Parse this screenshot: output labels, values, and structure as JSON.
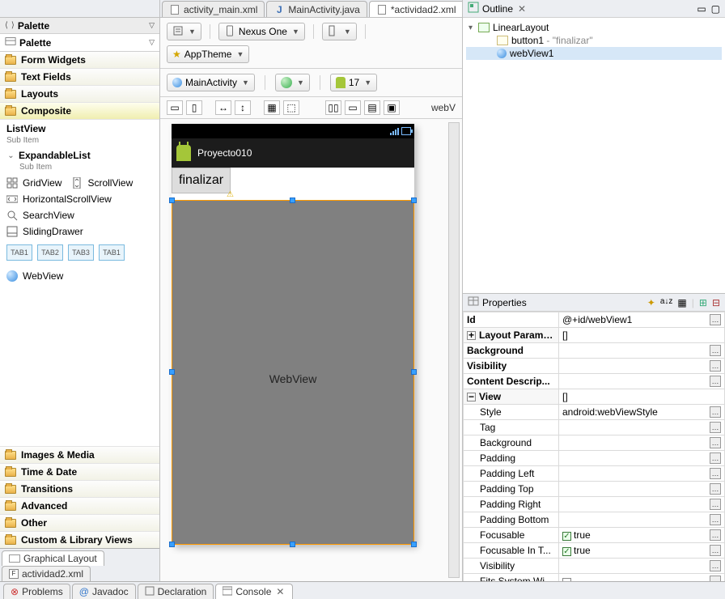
{
  "editor_tabs": [
    {
      "label": "activity_main.xml",
      "active": false,
      "icon": "xml"
    },
    {
      "label": "MainActivity.java",
      "active": false,
      "icon": "java"
    },
    {
      "label": "*actividad2.xml",
      "active": true,
      "icon": "xml"
    }
  ],
  "palette": {
    "title": "Palette",
    "categories_top": [
      {
        "label": "Form Widgets"
      },
      {
        "label": "Text Fields"
      },
      {
        "label": "Layouts"
      },
      {
        "label": "Composite",
        "selected": true
      }
    ],
    "items": {
      "listview": "ListView",
      "listview_sub": "Sub Item",
      "expandable": "ExpandableList",
      "expandable_sub": "Sub Item",
      "gridview": "GridView",
      "scrollview": "ScrollView",
      "hscroll": "HorizontalScrollView",
      "searchview": "SearchView",
      "slidingdrawer": "SlidingDrawer",
      "tabs": [
        "TAB1",
        "TAB2",
        "TAB3",
        "TAB1"
      ],
      "webview": "WebView"
    },
    "categories_bottom": [
      {
        "label": "Images & Media"
      },
      {
        "label": "Time & Date"
      },
      {
        "label": "Transitions"
      },
      {
        "label": "Advanced"
      },
      {
        "label": "Other"
      },
      {
        "label": "Custom & Library Views"
      }
    ]
  },
  "left_bottom_tabs": [
    "Graphical Layout",
    "actividad2.xml"
  ],
  "toolbar": {
    "device": "Nexus One",
    "theme_label": "AppTheme",
    "context": "MainActivity",
    "api": "17",
    "right_text": "webV"
  },
  "preview": {
    "app_title": "Proyecto010",
    "button_label": "finalizar",
    "webview_text": "WebView"
  },
  "outline": {
    "title": "Outline",
    "root": "LinearLayout",
    "child1": "button1",
    "child1_suffix": " - \"finalizar\"",
    "child2": "webView1"
  },
  "properties": {
    "title": "Properties",
    "rows": [
      {
        "k": "Id",
        "v": "@+id/webView1",
        "btn": true,
        "bold": true
      },
      {
        "k": "Layout Parameters",
        "v": "[]",
        "grp": true,
        "exp": "plus"
      },
      {
        "k": "Background",
        "v": "",
        "btn": true,
        "bold": true
      },
      {
        "k": "Visibility",
        "v": "",
        "btn": true,
        "bold": true
      },
      {
        "k": "Content Descrip...",
        "v": "",
        "btn": true,
        "bold": true
      },
      {
        "k": "View",
        "v": "[]",
        "grp": true,
        "exp": "minus"
      },
      {
        "k": "Style",
        "v": "android:webViewStyle",
        "btn": true,
        "indent": true
      },
      {
        "k": "Tag",
        "v": "",
        "btn": true,
        "indent": true
      },
      {
        "k": "Background",
        "v": "",
        "btn": true,
        "indent": true
      },
      {
        "k": "Padding",
        "v": "",
        "btn": true,
        "indent": true
      },
      {
        "k": "Padding Left",
        "v": "",
        "btn": true,
        "indent": true
      },
      {
        "k": "Padding Top",
        "v": "",
        "btn": true,
        "indent": true
      },
      {
        "k": "Padding Right",
        "v": "",
        "btn": true,
        "indent": true
      },
      {
        "k": "Padding Bottom",
        "v": "",
        "btn": true,
        "indent": true
      },
      {
        "k": "Focusable",
        "v": "true",
        "btn": true,
        "chk": true,
        "indent": true
      },
      {
        "k": "Focusable In T...",
        "v": "true",
        "btn": true,
        "chk": true,
        "indent": true
      },
      {
        "k": "Visibility",
        "v": "",
        "btn": true,
        "indent": true
      },
      {
        "k": "Fits System Wi...",
        "v": "",
        "btn": true,
        "chk_empty": true,
        "indent": true
      }
    ]
  },
  "bottom_tabs": [
    {
      "label": "Problems",
      "icon": "problems"
    },
    {
      "label": "Javadoc",
      "icon": "javadoc"
    },
    {
      "label": "Declaration",
      "icon": "declaration"
    },
    {
      "label": "Console",
      "icon": "console",
      "active": true
    }
  ]
}
